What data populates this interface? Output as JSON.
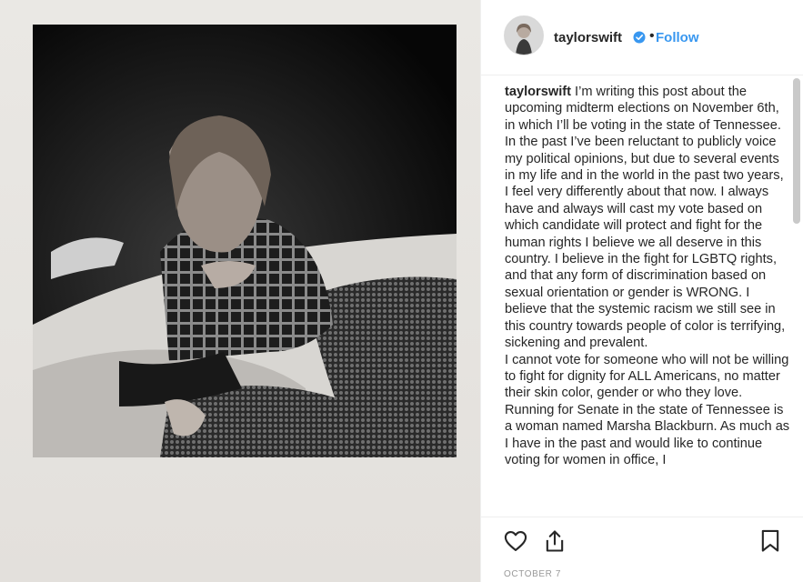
{
  "post": {
    "username": "taylorswift",
    "separator": "•",
    "follow_label": "Follow",
    "caption_user": "taylorswift",
    "caption_text": " I’m writing this post about the upcoming midterm elections on November 6th, in which I’ll be voting in the state of Tennessee. In the past I’ve been reluctant to publicly voice my political opinions, but due to several events in my life and in the world in the past two years, I feel very differently about that now. I always have and always will cast my vote based on which candidate will protect and fight for the human rights I believe we all deserve in this country. I believe in the fight for LGBTQ rights, and that any form of discrimination based on sexual orientation or gender is WRONG. I believe that the systemic racism we still see in this country towards people of color is terrifying, sickening and prevalent.\nI cannot vote for someone who will not be willing to fight for dignity for ALL Americans, no matter their skin color, gender or who they love. Running for Senate in the state of Tennessee is a woman named Marsha Blackburn. As much as I have in the past and would like to continue voting for women in office, I",
    "date": "OCTOBER 7"
  },
  "icons": {
    "verified": "verified-badge-icon",
    "like": "heart-icon",
    "share": "share-icon",
    "save": "bookmark-icon"
  },
  "colors": {
    "link": "#3897f0",
    "text": "#262626",
    "muted": "#999999",
    "divider": "#efefef"
  }
}
